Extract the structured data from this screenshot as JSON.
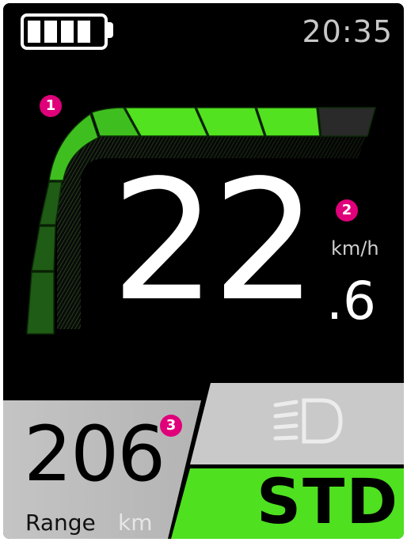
{
  "status_bar": {
    "battery_level": 1.0,
    "battery_cells": 4,
    "time": "20:35"
  },
  "gauge": {
    "marker": "1",
    "assist_level_fraction": 0.85,
    "colors": {
      "active": "#3fbf1f",
      "bright": "#52e21f",
      "inactive": "#2a2a2a",
      "dark": "#1f5c15"
    }
  },
  "speed": {
    "marker": "2",
    "integer": "22",
    "decimal": ".6",
    "unit": "km/h"
  },
  "range": {
    "marker": "3",
    "value": "206",
    "label": "Range",
    "unit": "km"
  },
  "light": {
    "icon": "headlight-icon",
    "state": "off"
  },
  "mode": {
    "label": "STD",
    "color": "#4fe020"
  }
}
